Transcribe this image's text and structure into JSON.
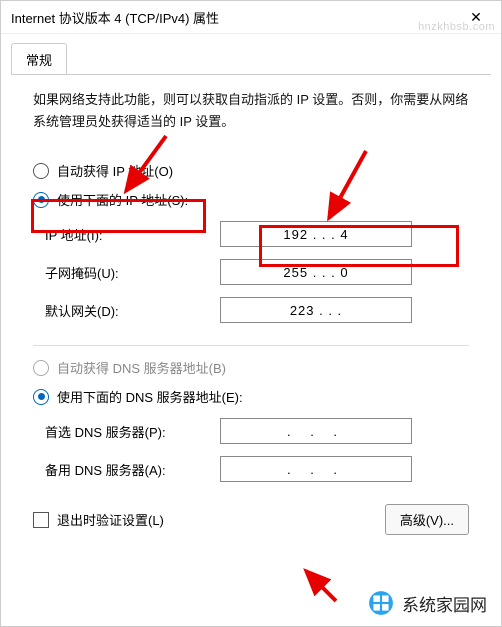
{
  "window": {
    "title": "Internet 协议版本 4 (TCP/IPv4) 属性",
    "close_glyph": "✕"
  },
  "tab": {
    "general": "常规"
  },
  "description": "如果网络支持此功能，则可以获取自动指派的 IP 设置。否则，你需要从网络系统管理员处获得适当的 IP 设置。",
  "ip_section": {
    "auto_label": "自动获得 IP 地址(O)",
    "manual_label": "使用下面的 IP 地址(S):",
    "ip_label": "IP 地址(I):",
    "ip_value": "192 .        .        .   4",
    "mask_label": "子网掩码(U):",
    "mask_value": "255 .        .        .   0",
    "gateway_label": "默认网关(D):",
    "gateway_value": "223 .        .        .    "
  },
  "dns_section": {
    "auto_label": "自动获得 DNS 服务器地址(B)",
    "manual_label": "使用下面的 DNS 服务器地址(E):",
    "pref_label": "首选 DNS 服务器(P):",
    "pref_value": ".     .     .",
    "alt_label": "备用 DNS 服务器(A):",
    "alt_value": ".     .     ."
  },
  "footer": {
    "validate_label": "退出时验证设置(L)",
    "advanced_label": "高级(V)..."
  },
  "branding": {
    "watermark": "hnzkhbsb.com",
    "site_name": "系统家园网"
  }
}
